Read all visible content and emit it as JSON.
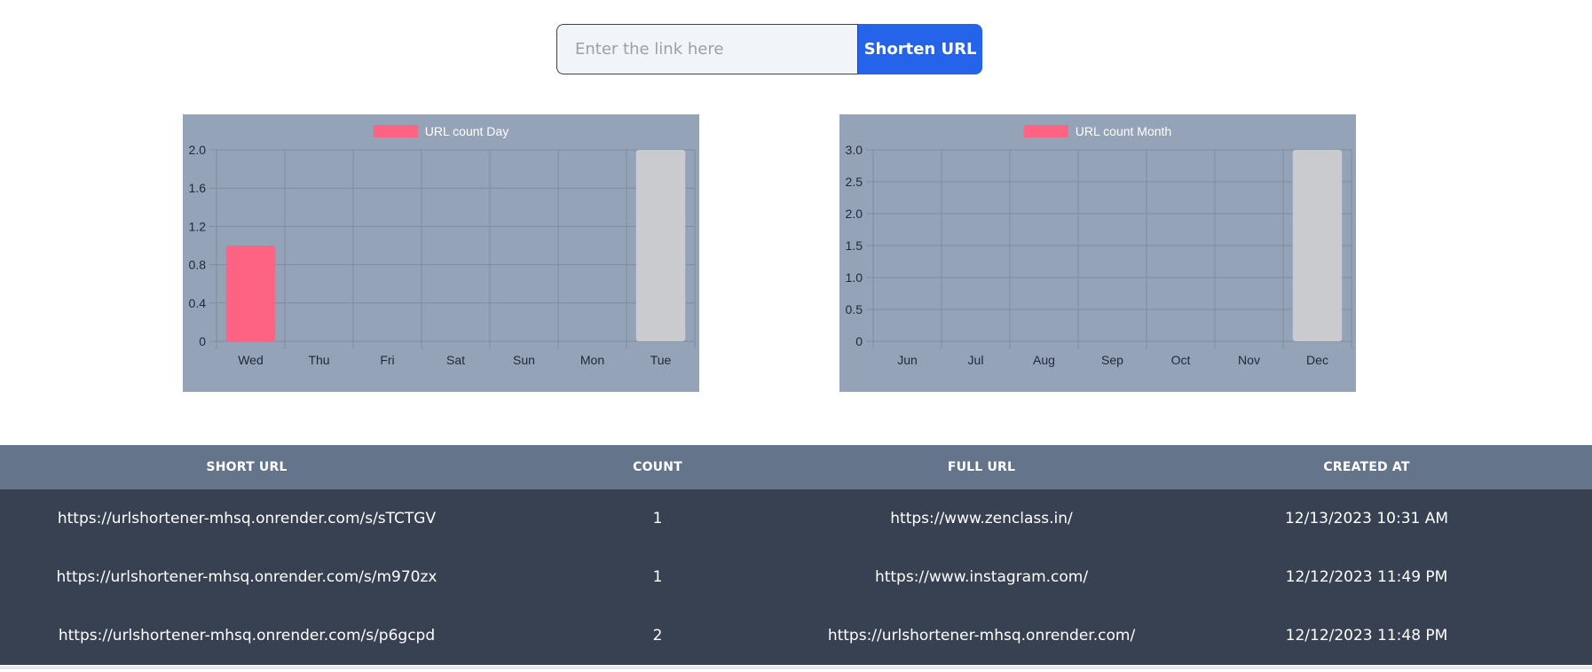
{
  "form": {
    "input_placeholder": "Enter the link here",
    "input_value": "",
    "button_label": "Shorten URL"
  },
  "chart_data": [
    {
      "type": "bar",
      "title": "",
      "legend": "URL count Day",
      "legend_position": "top",
      "categories": [
        "Wed",
        "Thu",
        "Fri",
        "Sat",
        "Sun",
        "Mon",
        "Tue"
      ],
      "series": [
        {
          "name": "URL count Day",
          "values": [
            1,
            0,
            0,
            0,
            0,
            0,
            2
          ],
          "colors": [
            "#ff6384",
            "#ff6384",
            "#ff6384",
            "#ff6384",
            "#ff6384",
            "#ff6384",
            "#c9cbcf"
          ]
        }
      ],
      "yticks": [
        "0",
        "0.4",
        "0.8",
        "1.2",
        "1.6",
        "2.0"
      ],
      "ylim": [
        0,
        2
      ],
      "grid": true,
      "xlabel": "",
      "ylabel": ""
    },
    {
      "type": "bar",
      "title": "",
      "legend": "URL count Month",
      "legend_position": "top",
      "categories": [
        "Jun",
        "Jul",
        "Aug",
        "Sep",
        "Oct",
        "Nov",
        "Dec"
      ],
      "series": [
        {
          "name": "URL count Month",
          "values": [
            0,
            0,
            0,
            0,
            0,
            0,
            3
          ],
          "colors": [
            "#ff6384",
            "#ff6384",
            "#ff6384",
            "#ff6384",
            "#ff6384",
            "#ff6384",
            "#c9cbcf"
          ]
        }
      ],
      "yticks": [
        "0",
        "0.5",
        "1.0",
        "1.5",
        "2.0",
        "2.5",
        "3.0"
      ],
      "ylim": [
        0,
        3
      ],
      "grid": true,
      "xlabel": "",
      "ylabel": ""
    }
  ],
  "table": {
    "headers": [
      "SHORT URL",
      "COUNT",
      "FULL URL",
      "CREATED AT"
    ],
    "rows": [
      {
        "short_url": "https://urlshortener-mhsq.onrender.com/s/sTCTGV",
        "count": "1",
        "full_url": "https://www.zenclass.in/",
        "created_at": "12/13/2023 10:31 AM"
      },
      {
        "short_url": "https://urlshortener-mhsq.onrender.com/s/m970zx",
        "count": "1",
        "full_url": "https://www.instagram.com/",
        "created_at": "12/12/2023 11:49 PM"
      },
      {
        "short_url": "https://urlshortener-mhsq.onrender.com/s/p6gcpd",
        "count": "2",
        "full_url": "https://urlshortener-mhsq.onrender.com/",
        "created_at": "12/12/2023 11:48 PM"
      }
    ]
  },
  "colors": {
    "legend_swatch": "#ff6384",
    "chart_background": "#94a3b8",
    "grid_line": "#808c9d",
    "tick_text": "#1f2937",
    "legend_text": "#ffffff",
    "table_header_bg": "#64748b",
    "table_body_bg": "#374151",
    "button_bg": "#2563eb"
  }
}
